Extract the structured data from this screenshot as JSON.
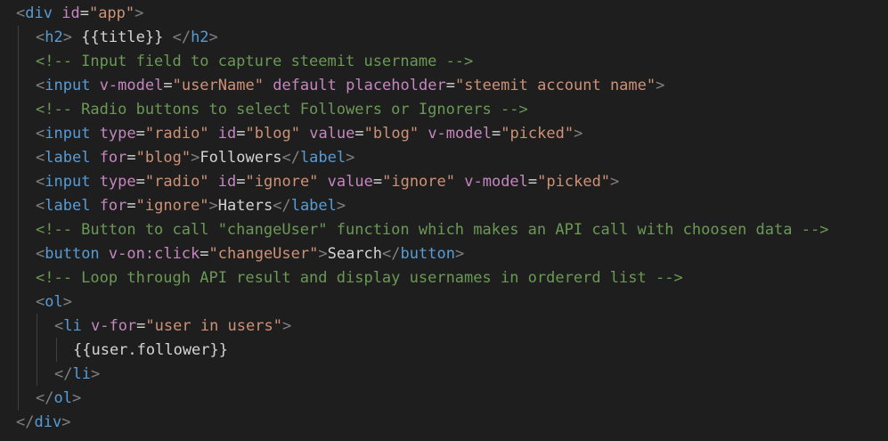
{
  "lines": [
    [
      [
        "bracket",
        "<"
      ],
      [
        "tag",
        "div"
      ],
      [
        "text",
        " "
      ],
      [
        "attr",
        "id"
      ],
      [
        "eq",
        "="
      ],
      [
        "string",
        "\"app\""
      ],
      [
        "bracket",
        ">"
      ]
    ],
    [
      [
        "bracket",
        "<"
      ],
      [
        "tag",
        "h2"
      ],
      [
        "bracket",
        ">"
      ],
      [
        "text",
        " {{title}} "
      ],
      [
        "bracket",
        "</"
      ],
      [
        "tag",
        "h2"
      ],
      [
        "bracket",
        ">"
      ]
    ],
    [
      [
        "comment",
        "<!-- Input field to capture steemit username -->"
      ]
    ],
    [
      [
        "bracket",
        "<"
      ],
      [
        "tag",
        "input"
      ],
      [
        "text",
        " "
      ],
      [
        "attr",
        "v-model"
      ],
      [
        "eq",
        "="
      ],
      [
        "string",
        "\"userName\""
      ],
      [
        "text",
        " "
      ],
      [
        "attr",
        "default"
      ],
      [
        "text",
        " "
      ],
      [
        "attr",
        "placeholder"
      ],
      [
        "eq",
        "="
      ],
      [
        "string",
        "\"steemit account name\""
      ],
      [
        "bracket",
        ">"
      ]
    ],
    [
      [
        "comment",
        "<!-- Radio buttons to select Followers or Ignorers -->"
      ]
    ],
    [
      [
        "bracket",
        "<"
      ],
      [
        "tag",
        "input"
      ],
      [
        "text",
        " "
      ],
      [
        "attr",
        "type"
      ],
      [
        "eq",
        "="
      ],
      [
        "string",
        "\"radio\""
      ],
      [
        "text",
        " "
      ],
      [
        "attr",
        "id"
      ],
      [
        "eq",
        "="
      ],
      [
        "string",
        "\"blog\""
      ],
      [
        "text",
        " "
      ],
      [
        "attr",
        "value"
      ],
      [
        "eq",
        "="
      ],
      [
        "string",
        "\"blog\""
      ],
      [
        "text",
        " "
      ],
      [
        "attr",
        "v-model"
      ],
      [
        "eq",
        "="
      ],
      [
        "string",
        "\"picked\""
      ],
      [
        "bracket",
        ">"
      ]
    ],
    [
      [
        "bracket",
        "<"
      ],
      [
        "tag",
        "label"
      ],
      [
        "text",
        " "
      ],
      [
        "attr",
        "for"
      ],
      [
        "eq",
        "="
      ],
      [
        "string",
        "\"blog\""
      ],
      [
        "bracket",
        ">"
      ],
      [
        "text",
        "Followers"
      ],
      [
        "bracket",
        "</"
      ],
      [
        "tag",
        "label"
      ],
      [
        "bracket",
        ">"
      ]
    ],
    [
      [
        "bracket",
        "<"
      ],
      [
        "tag",
        "input"
      ],
      [
        "text",
        " "
      ],
      [
        "attr",
        "type"
      ],
      [
        "eq",
        "="
      ],
      [
        "string",
        "\"radio\""
      ],
      [
        "text",
        " "
      ],
      [
        "attr",
        "id"
      ],
      [
        "eq",
        "="
      ],
      [
        "string",
        "\"ignore\""
      ],
      [
        "text",
        " "
      ],
      [
        "attr",
        "value"
      ],
      [
        "eq",
        "="
      ],
      [
        "string",
        "\"ignore\""
      ],
      [
        "text",
        " "
      ],
      [
        "attr",
        "v-model"
      ],
      [
        "eq",
        "="
      ],
      [
        "string",
        "\"picked\""
      ],
      [
        "bracket",
        ">"
      ]
    ],
    [
      [
        "bracket",
        "<"
      ],
      [
        "tag",
        "label"
      ],
      [
        "text",
        " "
      ],
      [
        "attr",
        "for"
      ],
      [
        "eq",
        "="
      ],
      [
        "string",
        "\"ignore\""
      ],
      [
        "bracket",
        ">"
      ],
      [
        "text",
        "Haters"
      ],
      [
        "bracket",
        "</"
      ],
      [
        "tag",
        "label"
      ],
      [
        "bracket",
        ">"
      ]
    ],
    [
      [
        "comment",
        "<!-- Button to call \"changeUser\" function which makes an API call with choosen data -->"
      ]
    ],
    [
      [
        "bracket",
        "<"
      ],
      [
        "tag",
        "button"
      ],
      [
        "text",
        " "
      ],
      [
        "attr",
        "v-on:click"
      ],
      [
        "eq",
        "="
      ],
      [
        "string",
        "\"changeUser\""
      ],
      [
        "bracket",
        ">"
      ],
      [
        "text",
        "Search"
      ],
      [
        "bracket",
        "</"
      ],
      [
        "tag",
        "button"
      ],
      [
        "bracket",
        ">"
      ]
    ],
    [
      [
        "comment",
        "<!-- Loop through API result and display usernames in ordererd list -->"
      ]
    ],
    [
      [
        "bracket",
        "<"
      ],
      [
        "tag",
        "ol"
      ],
      [
        "bracket",
        ">"
      ]
    ],
    [
      [
        "bracket",
        "<"
      ],
      [
        "tag",
        "li"
      ],
      [
        "text",
        " "
      ],
      [
        "attr",
        "v-for"
      ],
      [
        "eq",
        "="
      ],
      [
        "string",
        "\"user in users\""
      ],
      [
        "bracket",
        ">"
      ]
    ],
    [
      [
        "text",
        "{{user.follower}}"
      ]
    ],
    [
      [
        "bracket",
        "</"
      ],
      [
        "tag",
        "li"
      ],
      [
        "bracket",
        ">"
      ]
    ],
    [
      [
        "bracket",
        "</"
      ],
      [
        "tag",
        "ol"
      ],
      [
        "bracket",
        ">"
      ]
    ],
    [
      [
        "bracket",
        "</"
      ],
      [
        "tag",
        "div"
      ],
      [
        "bracket",
        ">"
      ]
    ]
  ]
}
